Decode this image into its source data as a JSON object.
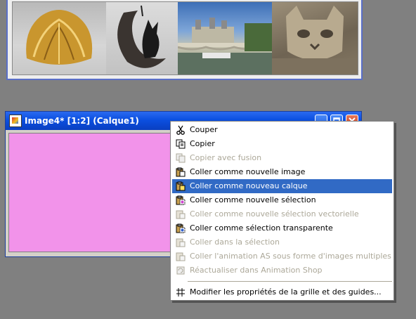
{
  "top_window": {
    "photos": [
      "golden-shell-sculpture",
      "black-cat-on-moon-sign",
      "seine-bridge-view",
      "stone-cat-sculpture"
    ]
  },
  "image4_window": {
    "title": "Image4* [1:2] (Calque1)",
    "canvas_color": "#f293ea",
    "title_buttons": [
      "minimize",
      "maximize",
      "close"
    ]
  },
  "context_menu": {
    "highlight_color": "#316ac5",
    "items": [
      {
        "label": "Couper",
        "icon": "scissors-icon",
        "enabled": true,
        "highlighted": false
      },
      {
        "label": "Copier",
        "icon": "copy-icon",
        "enabled": true,
        "highlighted": false
      },
      {
        "label": "Copier avec fusion",
        "icon": "copy-merged-icon",
        "enabled": false,
        "highlighted": false
      },
      {
        "label": "Coller comme nouvelle image",
        "icon": "paste-new-image-icon",
        "enabled": true,
        "highlighted": false
      },
      {
        "label": "Coller comme nouveau calque",
        "icon": "paste-new-layer-icon",
        "enabled": true,
        "highlighted": true
      },
      {
        "label": "Coller comme nouvelle sélection",
        "icon": "paste-selection-icon",
        "enabled": true,
        "highlighted": false
      },
      {
        "label": "Coller comme nouvelle sélection vectorielle",
        "icon": "paste-vector-selection-icon",
        "enabled": false,
        "highlighted": false
      },
      {
        "label": "Coller comme sélection transparente",
        "icon": "paste-transparent-selection-icon",
        "enabled": true,
        "highlighted": false
      },
      {
        "label": "Coller dans la sélection",
        "icon": "paste-into-selection-icon",
        "enabled": false,
        "highlighted": false
      },
      {
        "label": "Coller l'animation AS sous forme d'images multiples",
        "icon": "paste-animation-icon",
        "enabled": false,
        "highlighted": false
      },
      {
        "label": "Réactualiser dans Animation Shop",
        "icon": "refresh-animation-shop-icon",
        "enabled": false,
        "highlighted": false
      },
      {
        "label": "Modifier les propriétés de la grille et des guides...",
        "icon": "grid-icon",
        "enabled": true,
        "highlighted": false
      }
    ]
  }
}
